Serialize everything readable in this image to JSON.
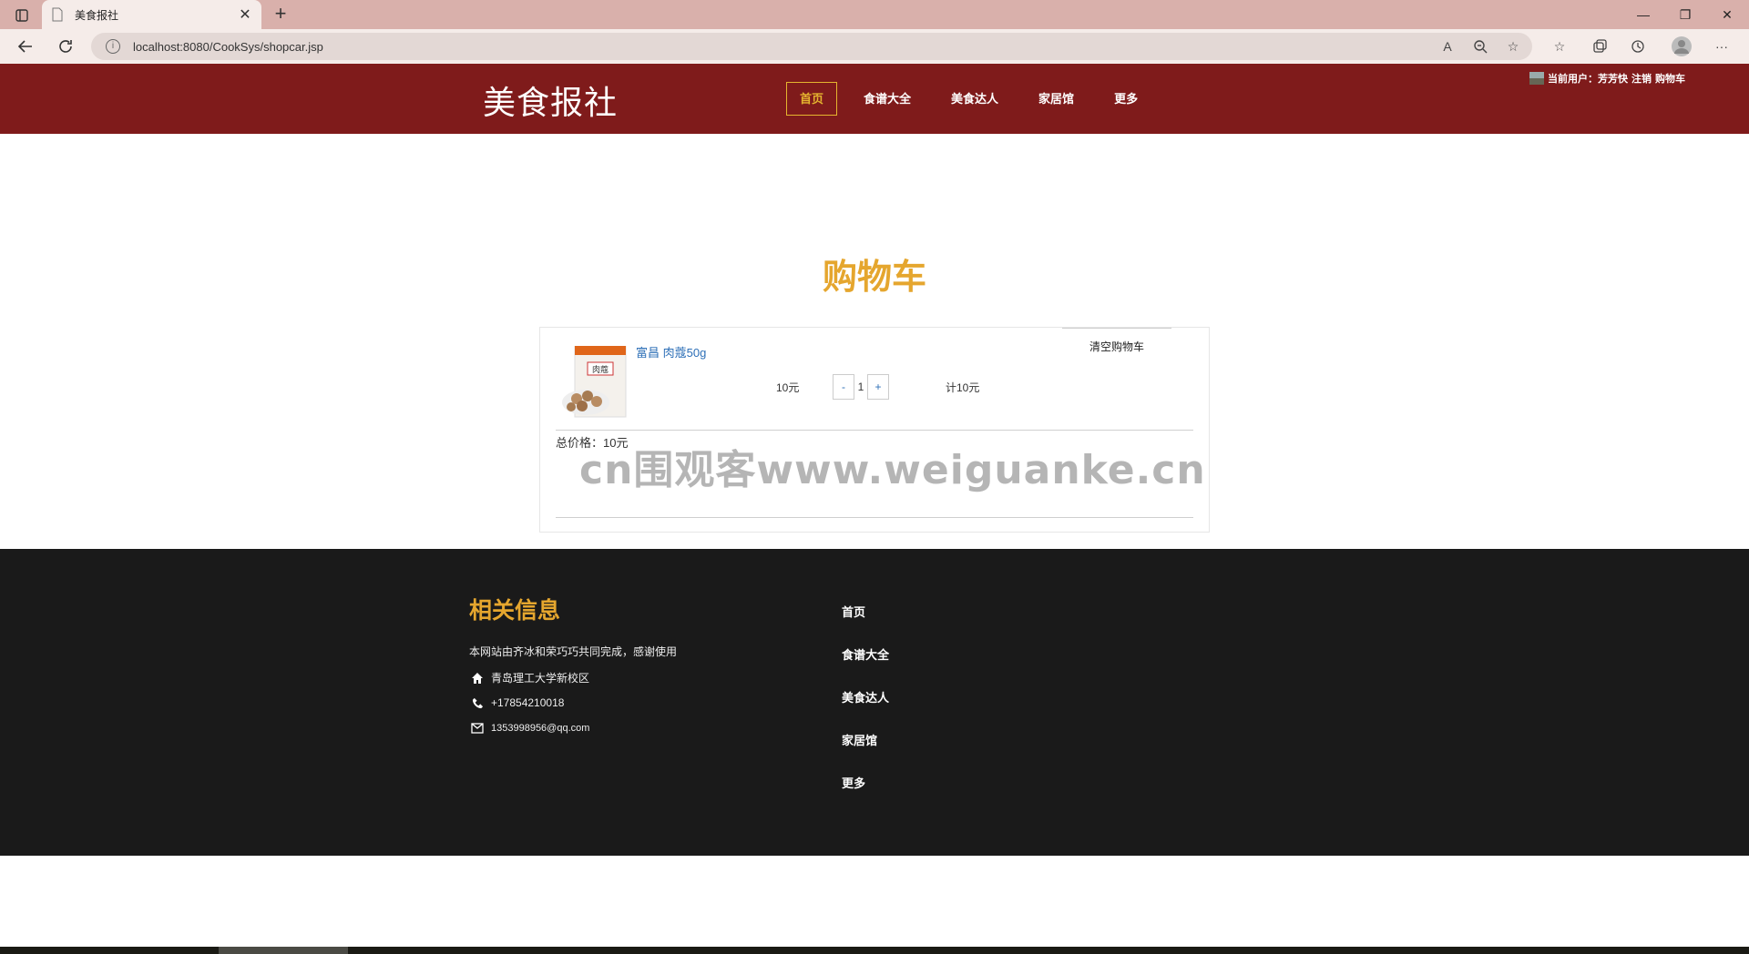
{
  "browser": {
    "tab_title": "美食报社",
    "url": "localhost:8080/CookSys/shopcar.jsp"
  },
  "header": {
    "logo": "美食报社",
    "nav": [
      "首页",
      "食谱大全",
      "美食达人",
      "家居馆",
      "更多"
    ],
    "active_nav": "首页",
    "user_label": "当前用户：",
    "user_name": "芳芳快",
    "logout": "注销",
    "cart": "购物车"
  },
  "cart": {
    "title": "购物车",
    "clear_label": "清空购物车",
    "items": [
      {
        "name": "富昌 肉蔻50g",
        "unit_price": "10元",
        "quantity": "1",
        "minus": "-",
        "plus": "+",
        "subtotal": "计10元"
      }
    ],
    "total": "总价格：10元"
  },
  "watermark": "cn围观客www.weiguanke.cn",
  "footer": {
    "title": "相关信息",
    "description": "本网站由齐冰和荣巧巧共同完成，感谢使用",
    "address": "青岛理工大学新校区",
    "phone": "+17854210018",
    "email": "1353998956@qq.com",
    "links": [
      "首页",
      "食谱大全",
      "美食达人",
      "家居馆",
      "更多"
    ]
  },
  "colors": {
    "header_bg": "#7f1b1b",
    "accent": "#e5a62e",
    "footer_bg": "#1a1a1a",
    "link": "#2d6fb7"
  }
}
